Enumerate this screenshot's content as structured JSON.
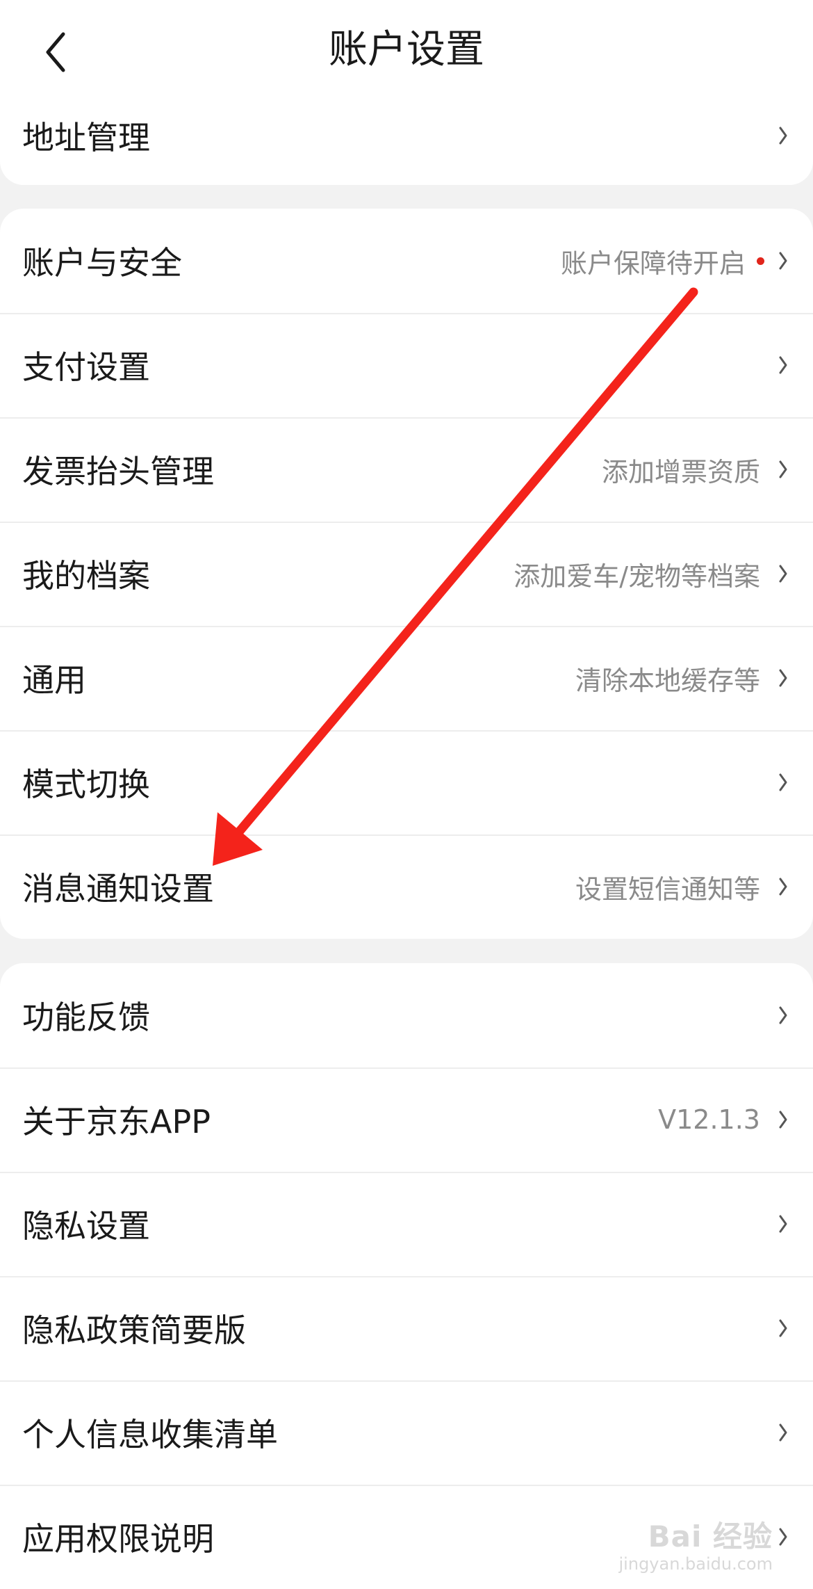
{
  "header": {
    "title": "账户设置"
  },
  "top_item": {
    "label": "地址管理",
    "value": ""
  },
  "group2": [
    {
      "label": "账户与安全",
      "value": "账户保障待开启",
      "dot": true
    },
    {
      "label": "支付设置",
      "value": ""
    },
    {
      "label": "发票抬头管理",
      "value": "添加增票资质"
    },
    {
      "label": "我的档案",
      "value": "添加爱车/宠物等档案"
    },
    {
      "label": "通用",
      "value": "清除本地缓存等"
    },
    {
      "label": "模式切换",
      "value": ""
    },
    {
      "label": "消息通知设置",
      "value": "设置短信通知等"
    }
  ],
  "group3": [
    {
      "label": "功能反馈",
      "value": ""
    },
    {
      "label": "关于京东APP",
      "value": "V12.1.3"
    },
    {
      "label": "隐私设置",
      "value": ""
    },
    {
      "label": "隐私政策简要版",
      "value": ""
    },
    {
      "label": "个人信息收集清单",
      "value": ""
    },
    {
      "label": "应用权限说明",
      "value": ""
    }
  ],
  "watermark": {
    "main": "Bai 经验",
    "sub": "jingyan.baidu.com"
  },
  "colors": {
    "accent": "#e1251b",
    "arrow": "#f4231b",
    "background": "#f2f2f2"
  },
  "icons": {
    "back": "chevron-left-icon",
    "row": "chevron-right-icon"
  }
}
